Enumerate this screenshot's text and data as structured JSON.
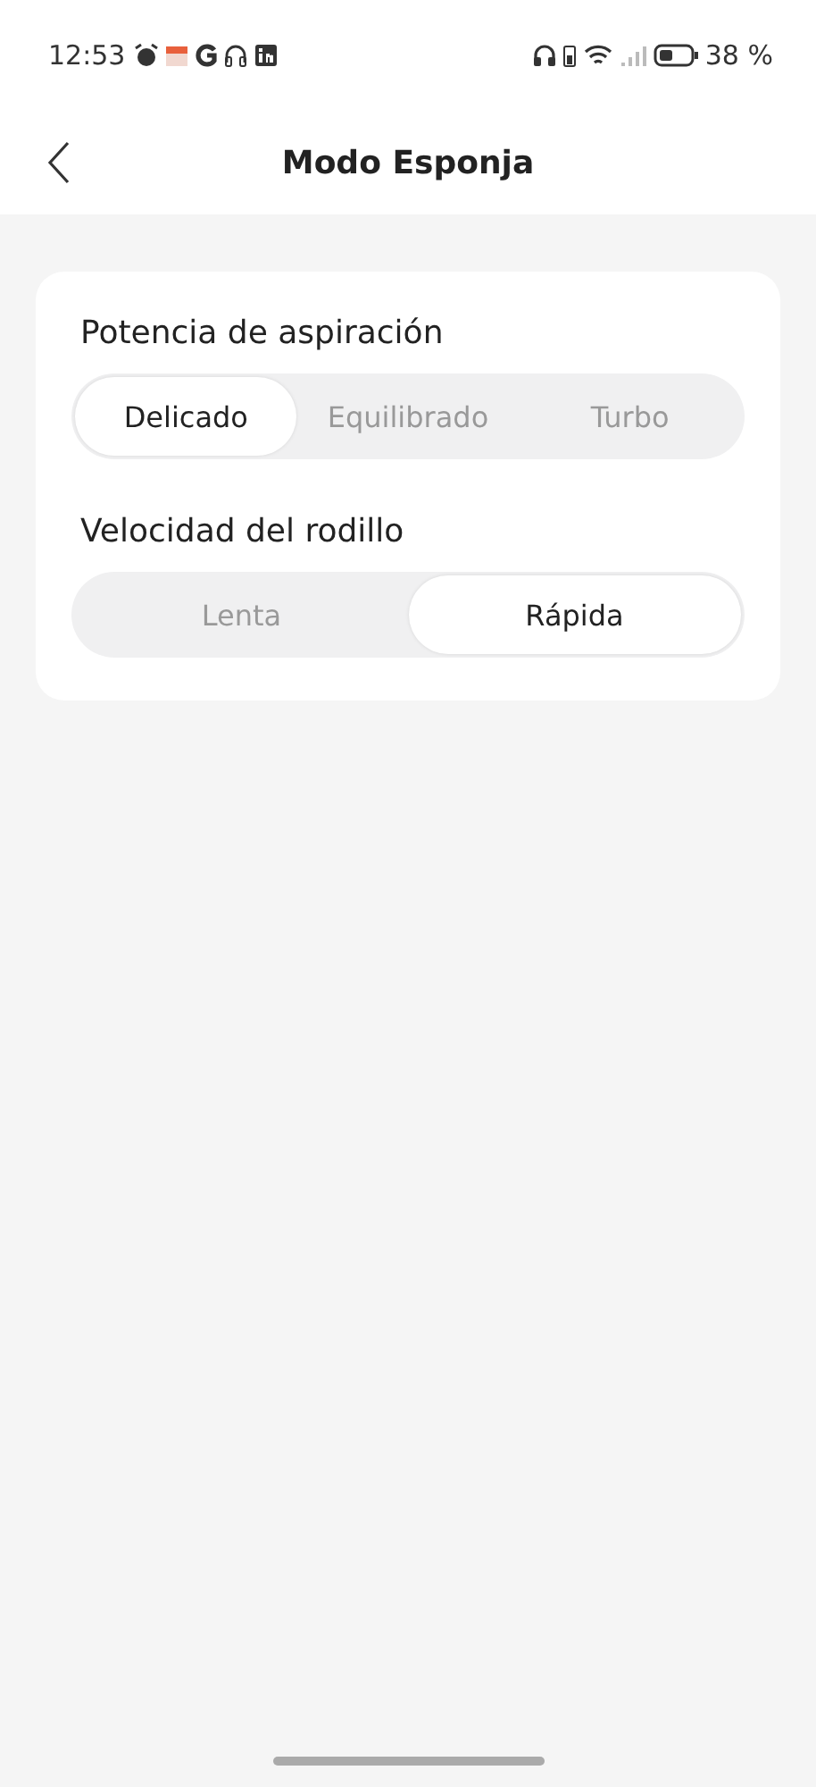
{
  "status_bar": {
    "time": "12:53",
    "battery": "38 %"
  },
  "header": {
    "title": "Modo Esponja"
  },
  "settings": [
    {
      "label": "Potencia de aspiración",
      "options": [
        {
          "label": "Delicado",
          "selected": true
        },
        {
          "label": "Equilibrado",
          "selected": false
        },
        {
          "label": "Turbo",
          "selected": false
        }
      ]
    },
    {
      "label": "Velocidad del rodillo",
      "options": [
        {
          "label": "Lenta",
          "selected": false
        },
        {
          "label": "Rápida",
          "selected": true
        }
      ]
    }
  ]
}
